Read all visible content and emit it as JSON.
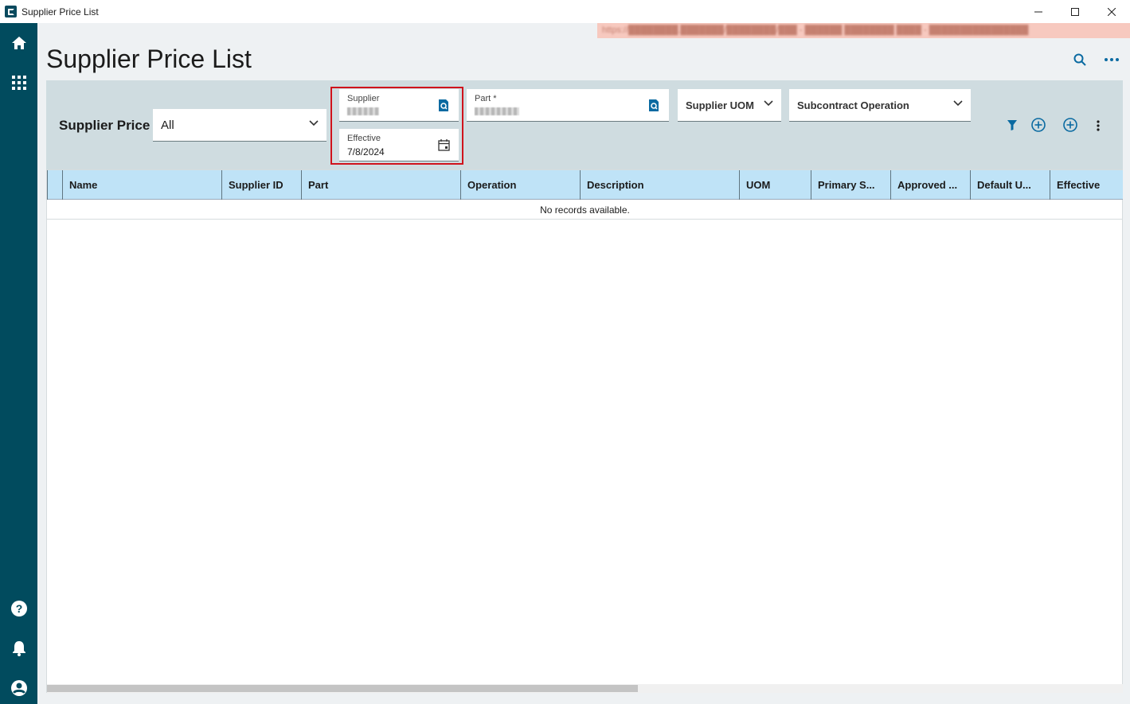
{
  "window": {
    "title": "Supplier Price List",
    "url": "https://████████.███████/████████/███ - ██████ ████████ ████ - ████████████████"
  },
  "header": {
    "title": "Supplier Price List"
  },
  "filters": {
    "panel_label": "Supplier Price",
    "type_select_value": "All",
    "supplier_label": "Supplier",
    "supplier_value": "",
    "effective_label": "Effective",
    "effective_value": "7/8/2024",
    "part_label": "Part *",
    "part_value": "",
    "supplier_uom_label": "Supplier UOM",
    "subcontract_label": "Subcontract Operation"
  },
  "grid": {
    "columns": [
      "Name",
      "Supplier ID",
      "Part",
      "Operation",
      "Description",
      "UOM",
      "Primary S...",
      "Approved ...",
      "Default U...",
      "Effective"
    ],
    "empty_message": "No records available."
  },
  "colors": {
    "rail": "#014b5e",
    "accent": "#0a6aa1",
    "highlight": "#d0131c",
    "grid_header": "#bfe3f7"
  }
}
